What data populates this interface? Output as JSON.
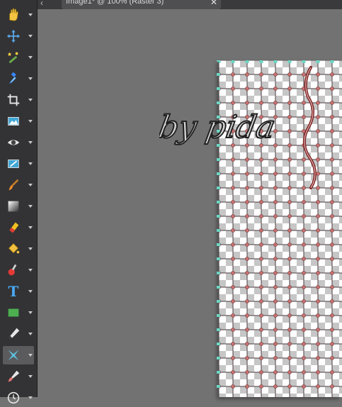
{
  "document_tab": {
    "scroll_arrow": "‹",
    "title": "Image1* @ 100% (Raster 3)",
    "close_glyph": "✕"
  },
  "toolbar": {
    "tools": [
      {
        "icon": "pan-hand-icon"
      },
      {
        "icon": "move-icon"
      },
      {
        "icon": "magic-wand-icon"
      },
      {
        "icon": "dropper-icon"
      },
      {
        "icon": "crop-icon"
      },
      {
        "icon": "straighten-icon"
      },
      {
        "icon": "red-eye-icon"
      },
      {
        "icon": "makeover-icon"
      },
      {
        "icon": "paint-brush-icon"
      },
      {
        "icon": "gradient-icon"
      },
      {
        "icon": "eraser-icon"
      },
      {
        "icon": "flood-fill-icon"
      },
      {
        "icon": "picture-tube-icon"
      },
      {
        "icon": "text-icon",
        "glyph": "T"
      },
      {
        "icon": "rectangle-shape-icon"
      },
      {
        "icon": "pen-icon"
      },
      {
        "icon": "warp-brush-icon",
        "active": true
      },
      {
        "icon": "art-brush-icon"
      },
      {
        "icon": "clock-icon"
      }
    ]
  },
  "canvas": {
    "watermark_text": "by pida",
    "colors": {
      "checker_dark": "#c6c6c6",
      "checker_light": "#ffffff",
      "grid_line": "#4a3a3f",
      "grid_node": "#c9706f",
      "handle": "#6cd6c4"
    }
  }
}
